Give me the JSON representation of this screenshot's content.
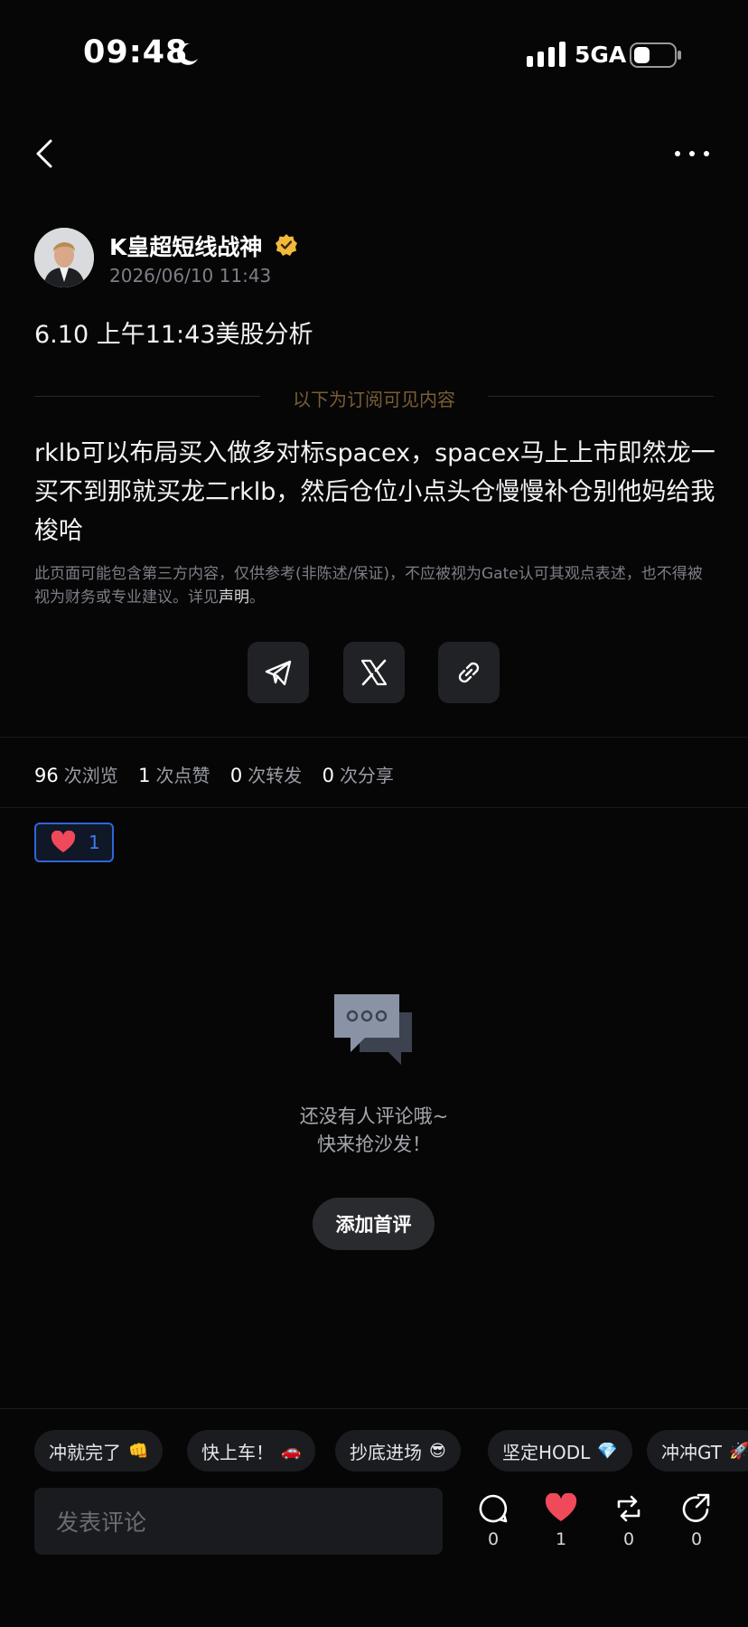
{
  "status_bar": {
    "time": "09:48",
    "network": "5GA",
    "icons": [
      "moon-icon",
      "signal-icon",
      "battery-icon"
    ]
  },
  "nav": {
    "back_icon": "chevron-left-icon",
    "more_icon": "more-dots-icon"
  },
  "post": {
    "author_name": "K皇超短线战神",
    "date": "2026/06/10 11:43",
    "title": "6.10 上午11:43美股分析",
    "subscriber_divider": "以下为订阅可见内容",
    "body": "rklb可以布局买入做多对标spacex，spacex马上上市即然龙一买不到那就买龙二rklb，然后仓位小点头仓慢慢补仓别他妈给我梭哈",
    "disclaimer": "此页面可能包含第三方内容，仅供参考(非陈述/保证)，不应被视为Gate认可其观点表述，也不得被视为财务或专业建议。详见",
    "disclaimer_link": "声明",
    "disclaimer_end": "。"
  },
  "share": {
    "icons": [
      "telegram-icon",
      "x-logo-icon",
      "link-icon"
    ]
  },
  "stats": {
    "views": "96",
    "views_label": "次浏览",
    "likes": "1",
    "likes_label": "次点赞",
    "reposts": "0",
    "reposts_label": "次转发",
    "shares": "0",
    "shares_label": "次分享"
  },
  "reaction": {
    "count": "1"
  },
  "comments_empty": {
    "line1": "还没有人评论哦~",
    "line2": "快来抢沙发！",
    "button": "添加首评"
  },
  "quick_replies": [
    {
      "text": "冲就完了",
      "emoji": "👊"
    },
    {
      "text": "快上车！",
      "emoji": "🚗"
    },
    {
      "text": "抄底进场",
      "emoji": "😎"
    },
    {
      "text": "坚定HODL",
      "emoji": "💎"
    },
    {
      "text": "冲冲GT",
      "emoji": "🚀"
    }
  ],
  "bottom_bar": {
    "input_placeholder": "发表评论",
    "comment_count": "0",
    "like_count": "1",
    "repost_count": "0",
    "share_count": "0"
  },
  "colors": {
    "background": "#060607",
    "accent_blue": "#2f66d8",
    "like_red": "#f0495a",
    "gold_badge": "#f2b93b",
    "subscriber_text": "#7a5d33"
  }
}
